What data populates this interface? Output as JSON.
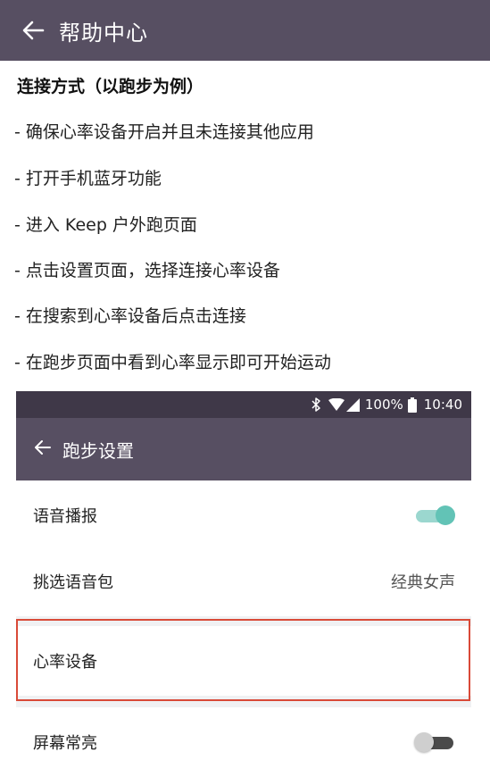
{
  "appbar": {
    "title": "帮助中心",
    "back_icon": "arrow-left-icon"
  },
  "guide": {
    "heading": "连接方式（以跑步为例）",
    "steps": [
      "- 确保心率设备开启并且未连接其他应用",
      "- 打开手机蓝牙功能",
      "- 进入 Keep 户外跑页面",
      "- 点击设置页面，选择连接心率设备",
      "- 在搜索到心率设备后点击连接",
      "- 在跑步页面中看到心率显示即可开始运动"
    ]
  },
  "screenshot": {
    "status": {
      "battery": "100%",
      "time": "10:40"
    },
    "toolbar_title": "跑步设置",
    "rows": [
      {
        "label": "语音播报",
        "switch": "on"
      },
      {
        "label": "挑选语音包",
        "value": "经典女声"
      },
      {
        "label": "心率设备"
      },
      {
        "label": "屏幕常亮",
        "switch": "off"
      }
    ]
  },
  "colors": {
    "appbar": "#574f62",
    "statusbar": "#3f3848",
    "accent": "#62c3b6",
    "highlight": "#d94a38"
  }
}
